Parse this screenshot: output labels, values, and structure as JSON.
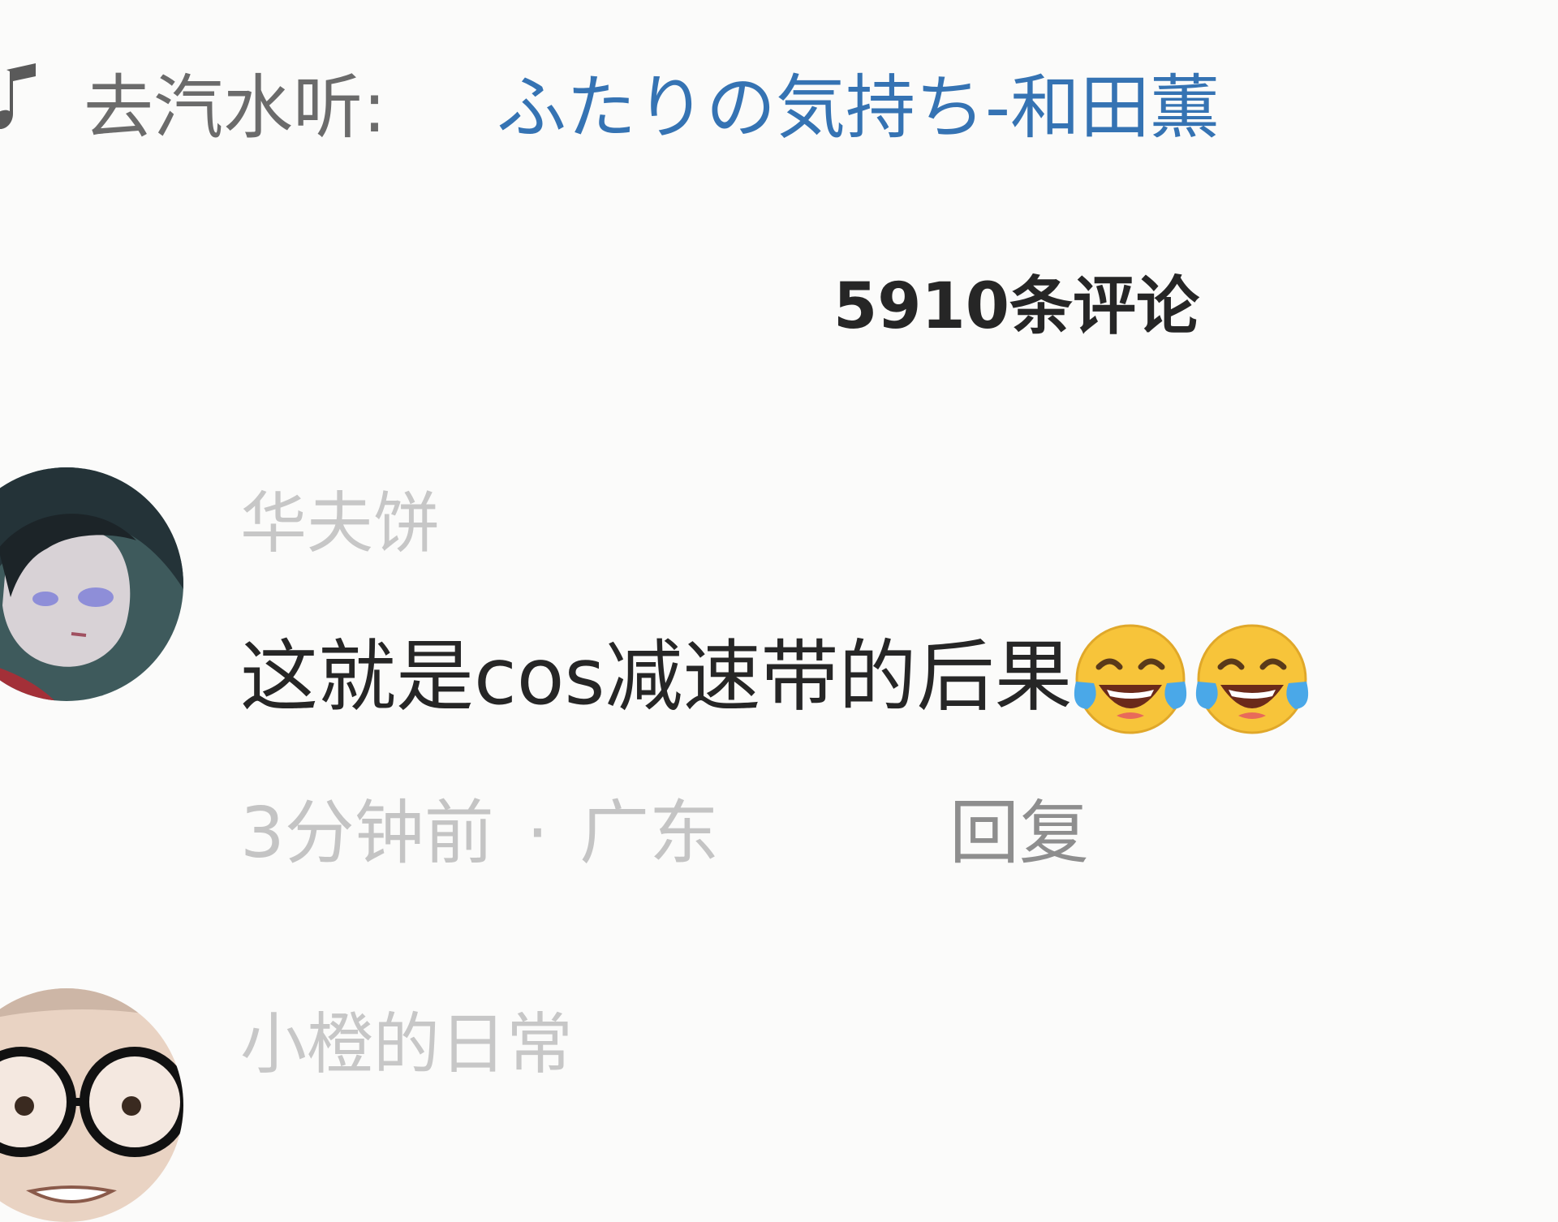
{
  "music": {
    "prefix": "去汽水听:",
    "song": "ふたりの気持ち-和田薫",
    "link_color": "#3573b3"
  },
  "comments_header": {
    "count_label": "5910条评论"
  },
  "comments": [
    {
      "username": "华夫饼",
      "text": "这就是cos减速带的后果",
      "emojis": [
        "laughing-crying-emoji",
        "laughing-crying-emoji"
      ],
      "time": "3分钟前",
      "separator": "·",
      "location": "广东",
      "reply_label": "回复"
    },
    {
      "username": "小橙的日常"
    }
  ]
}
